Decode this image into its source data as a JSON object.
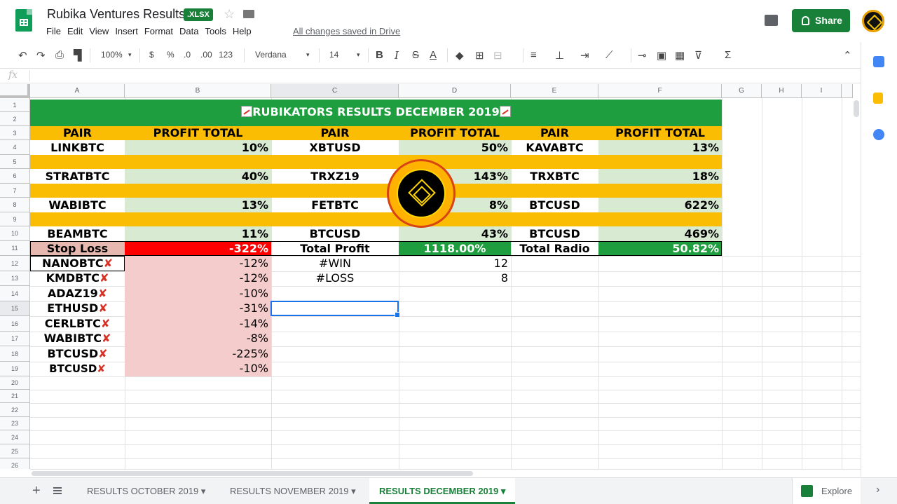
{
  "header": {
    "title": "Rubika Ventures Results",
    "badge": ".XLSX",
    "saved": "All changes saved in Drive",
    "share_label": "Share",
    "menu": [
      "File",
      "Edit",
      "View",
      "Insert",
      "Format",
      "Data",
      "Tools",
      "Help"
    ]
  },
  "toolbar": {
    "zoom": "100%",
    "currency": "$",
    "percent": "%",
    "decrease_decimal": ".0",
    "increase_decimal": ".00",
    "more_formats": "123",
    "font": "Verdana",
    "font_size": "14"
  },
  "formula_bar": {
    "fx": "fx",
    "value": ""
  },
  "columns": [
    "A",
    "B",
    "C",
    "D",
    "E",
    "F",
    "G",
    "H",
    "I"
  ],
  "rows": [
    "1",
    "2",
    "3",
    "4",
    "5",
    "6",
    "7",
    "8",
    "9",
    "10",
    "11",
    "12",
    "13",
    "14",
    "15",
    "16",
    "17",
    "18",
    "19",
    "20",
    "21",
    "22",
    "23",
    "24",
    "25",
    "26"
  ],
  "sheet": {
    "title": "RUBIKATORS RESULTS DECEMBER 2019",
    "headers": [
      "PAIR",
      "PROFIT TOTAL",
      "PAIR",
      "PROFIT TOTAL",
      "PAIR",
      "PROFIT TOTAL"
    ],
    "rows": [
      [
        "LINKBTC",
        "10%",
        "XBTUSD",
        "50%",
        "KAVABTC",
        "13%"
      ],
      [
        "STRATBTC",
        "40%",
        "TRXZ19",
        "143%",
        "TRXBTC",
        "18%"
      ],
      [
        "WABIBTC",
        "13%",
        "FETBTC",
        "8%",
        "BTCUSD",
        "622%"
      ],
      [
        "BEAMBTC",
        "11%",
        "BTCUSD",
        "43%",
        "BTCUSD",
        "469%"
      ]
    ],
    "summary": {
      "stop_loss_label": "Stop Loss",
      "stop_loss_value": "-322%",
      "total_profit_label": "Total Profit",
      "total_profit_value": "1118.00%",
      "total_radio_label": "Total Radio",
      "total_radio_value": "50.82%"
    },
    "losses": [
      {
        "pair": "NANOBTC",
        "value": "-12%"
      },
      {
        "pair": "KMDBTC",
        "value": "-12%"
      },
      {
        "pair": "ADAZ19",
        "value": "-10%"
      },
      {
        "pair": "ETHUSD",
        "value": "-31%"
      },
      {
        "pair": "CERLBTC",
        "value": "-14%"
      },
      {
        "pair": "WABIBTC",
        "value": "-8%"
      },
      {
        "pair": "BTCUSD",
        "value": "-225%"
      },
      {
        "pair": "BTCUSD",
        "value": "-10%"
      }
    ],
    "stats": [
      {
        "label": "#WIN",
        "value": "12"
      },
      {
        "label": "#LOSS",
        "value": "8"
      }
    ]
  },
  "tabs": [
    "RESULTS OCTOBER 2019",
    "RESULTS NOVEMBER 2019",
    "RESULTS DECEMBER 2019"
  ],
  "explore_label": "Explore",
  "colors": {
    "green": "#1e9e3e",
    "yellow": "#fbbc04",
    "light_green": "#d9ead3",
    "red": "#ff0000",
    "pink": "#f4cccc",
    "brand": "#188038"
  }
}
